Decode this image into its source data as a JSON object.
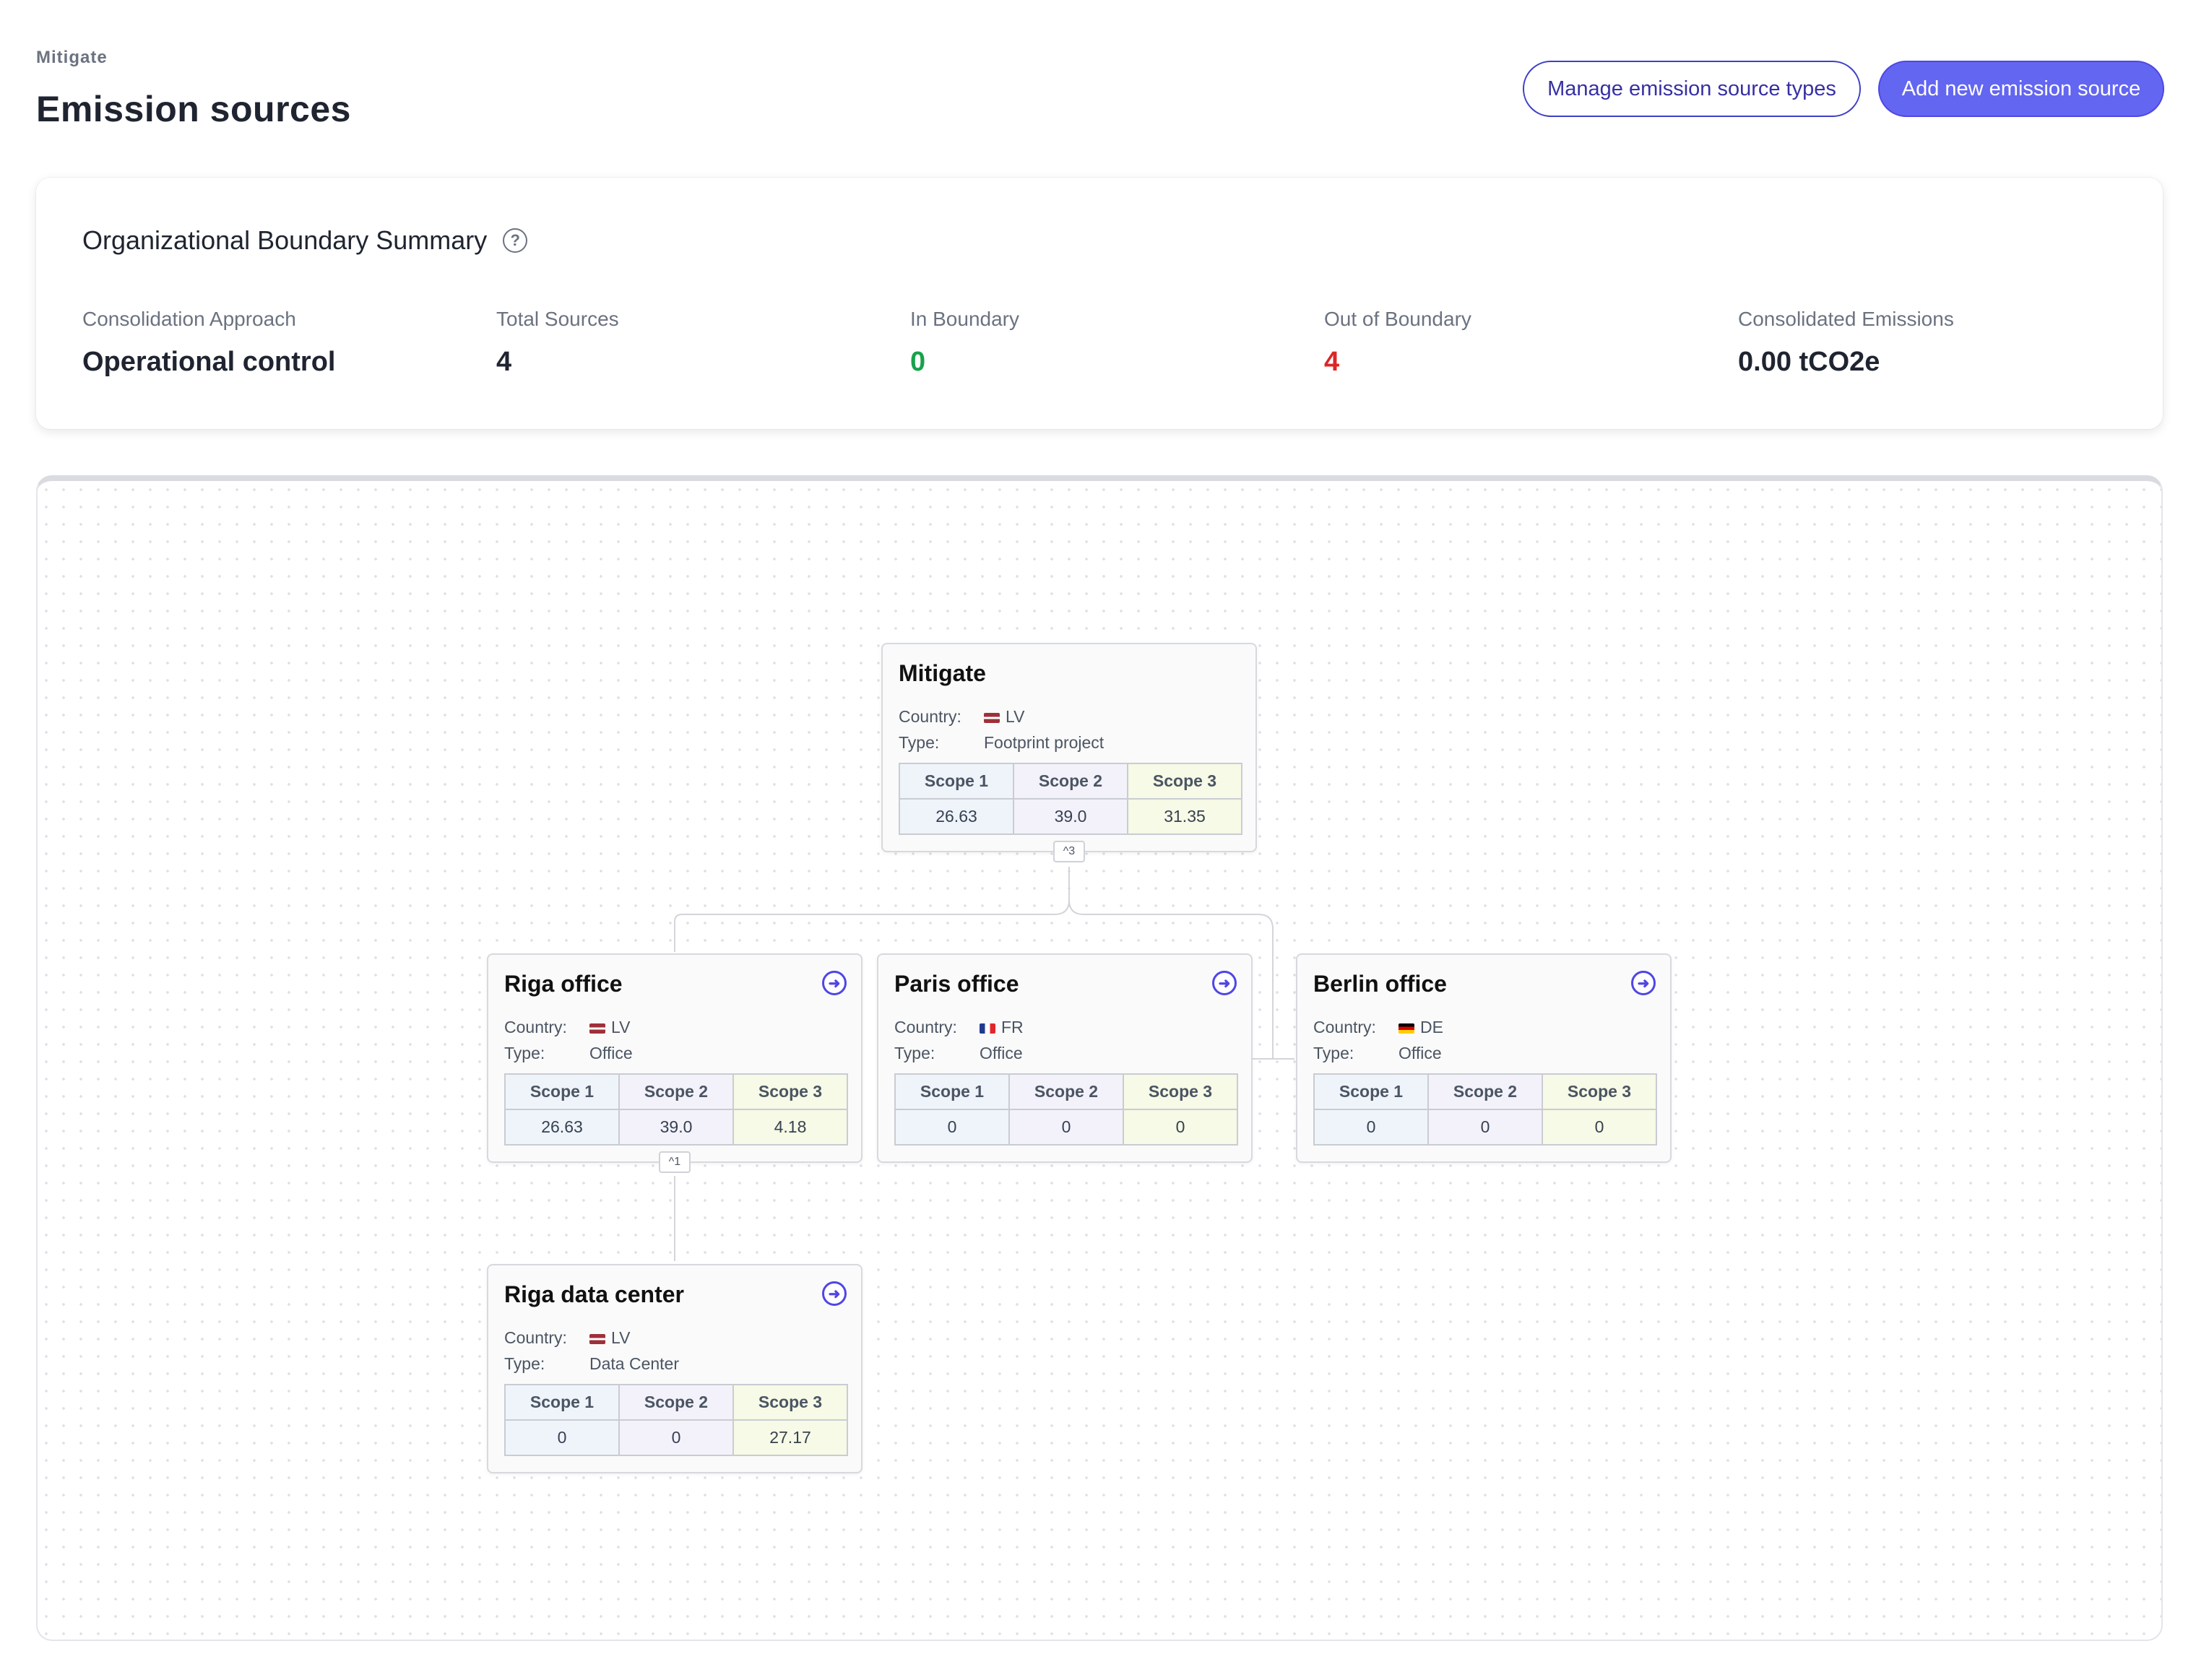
{
  "header": {
    "breadcrumb": "Mitigate",
    "title": "Emission sources",
    "manage_button": "Manage emission source types",
    "add_button": "Add new emission source"
  },
  "summary": {
    "title": "Organizational Boundary Summary",
    "help_icon": "question-circle-icon",
    "metrics": [
      {
        "label": "Consolidation Approach",
        "value": "Operational control"
      },
      {
        "label": "Total Sources",
        "value": "4"
      },
      {
        "label": "In Boundary",
        "value": "0"
      },
      {
        "label": "Out of Boundary",
        "value": "4"
      },
      {
        "label": "Consolidated Emissions",
        "value": "0.00 tCO2e"
      }
    ]
  },
  "tree": {
    "labels": {
      "country": "Country:",
      "type": "Type:",
      "scope1": "Scope 1",
      "scope2": "Scope 2",
      "scope3": "Scope 3"
    },
    "nodes": [
      {
        "name": "Mitigate",
        "country": "LV",
        "type": "Footprint project",
        "scope1": "26.63",
        "scope2": "39.0",
        "scope3": "31.35",
        "children_badge": "^3"
      },
      {
        "name": "Riga office",
        "country": "LV",
        "type": "Office",
        "scope1": "26.63",
        "scope2": "39.0",
        "scope3": "4.18",
        "children_badge": "^1"
      },
      {
        "name": "Paris office",
        "country": "FR",
        "type": "Office",
        "scope1": "0",
        "scope2": "0",
        "scope3": "0"
      },
      {
        "name": "Berlin office",
        "country": "DE",
        "type": "Office",
        "scope1": "0",
        "scope2": "0",
        "scope3": "0"
      },
      {
        "name": "Riga data center",
        "country": "LV",
        "type": "Data Center",
        "scope1": "0",
        "scope2": "0",
        "scope3": "27.17"
      }
    ]
  },
  "colors": {
    "accent": "#6366f1",
    "in_boundary": "#16a34a",
    "out_of_boundary": "#dc2626",
    "scope1_bg": "#eff4fb",
    "scope2_bg": "#f3f2fb",
    "scope3_bg": "#f6fae6"
  }
}
